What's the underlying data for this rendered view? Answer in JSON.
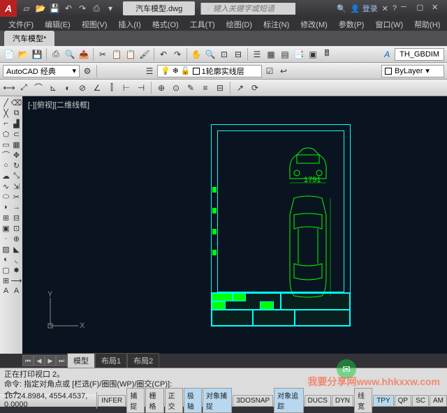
{
  "title": {
    "doc": "汽车模型.dwg",
    "search_placeholder": "键入关键字或短语",
    "login": "登录"
  },
  "menus": [
    "文件(F)",
    "编辑(E)",
    "视图(V)",
    "插入(I)",
    "格式(O)",
    "工具(T)",
    "绘图(D)",
    "标注(N)",
    "修改(M)",
    "参数(P)",
    "窗口(W)",
    "帮助(H)"
  ],
  "doc_tab": "汽车模型*",
  "workspace": "AutoCAD 经典",
  "layer": {
    "name": "1轮廓实线层"
  },
  "style_box": "TH_GBDIM",
  "bylayer": "ByLayer",
  "view_label": "[-][俯视][二维线框]",
  "ucs": {
    "x": "X",
    "y": "Y"
  },
  "layout_tabs": [
    "模型",
    "布局1",
    "布局2"
  ],
  "cmd": {
    "line1": "正在打印视口 2。",
    "line2": "命令: 指定对角点或 [栏选(F)/圈围(WP)/圈交(CP)]:",
    "prompt": "命令:"
  },
  "status": {
    "coords": "16724.8984, 4554.4537, 0.0000",
    "buttons": [
      "INFER",
      "捕捉",
      "栅格",
      "正交",
      "极轴",
      "对象捕捉",
      "3DOSNAP",
      "对象追踪",
      "DUCS",
      "DYN",
      "线宽",
      "TPY",
      "QP",
      "SC",
      "AM"
    ]
  },
  "watermark": "我要分享网www.hhkxxw.com",
  "qat_icons": [
    "new",
    "open",
    "save",
    "undo",
    "redo",
    "print",
    "plot"
  ],
  "title_icons": [
    "help",
    "dropdown"
  ]
}
